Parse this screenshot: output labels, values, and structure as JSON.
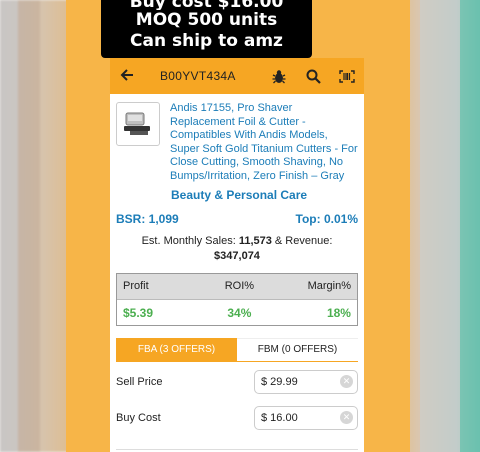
{
  "overlay": {
    "line0": "Buy cost $16.00",
    "line1": "MOQ 500 units",
    "line2": "Can ship to amz"
  },
  "toolbar": {
    "asin": "B00YVT434A",
    "icons": [
      "back-arrow-icon",
      "bug-icon",
      "search-icon",
      "barcode-scan-icon"
    ]
  },
  "product": {
    "title": "Andis 17155, Pro Shaver Replacement Foil & Cutter - Compatibles With Andis Models, Super Soft Gold Titanium Cutters - For Close Cutting, Smooth Shaving, No Bumps/Irritation, Zero Finish – Gray",
    "category": "Beauty & Personal Care"
  },
  "stats": {
    "bsr": "BSR: 1,099",
    "top": "Top: 0.01%",
    "sales_prefix": "Est. Monthly Sales: ",
    "sales_value": "11,573",
    "sales_mid": " & Revenue:",
    "revenue": "$347,074"
  },
  "metrics": {
    "headers": [
      "Profit",
      "ROI%",
      "Margin%"
    ],
    "values": [
      "$5.39",
      "34%",
      "18%"
    ]
  },
  "tabs": [
    {
      "label": "FBA (3 OFFERS)",
      "active": true
    },
    {
      "label": "FBM (0 OFFERS)",
      "active": false
    }
  ],
  "fields": {
    "sell_price_label": "Sell Price",
    "sell_price_value": "$  29.99",
    "buy_cost_label": "Buy Cost",
    "buy_cost_value": "$  16.00"
  },
  "colors": {
    "accent": "#f6a623",
    "link": "#1c7db8",
    "positive": "#4caf50"
  }
}
